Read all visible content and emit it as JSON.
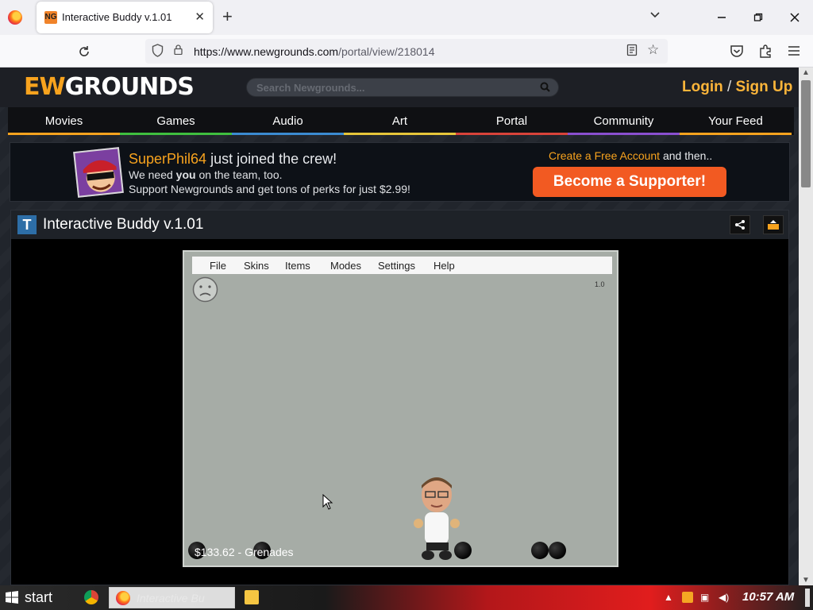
{
  "browser": {
    "tab_title": "Interactive Buddy v.1.01",
    "tab_favicon": "NG",
    "url_host": "https://www.newgrounds.com",
    "url_path": "/portal/view/218014"
  },
  "header": {
    "logo_accent": "EW",
    "logo_rest": "GROUNDS",
    "search_placeholder": "Search Newgrounds...",
    "login": "Login",
    "separator": "/",
    "signup": "Sign Up"
  },
  "nav": [
    {
      "label": "Movies",
      "color": "#f8a31e"
    },
    {
      "label": "Games",
      "color": "#3fbf3f"
    },
    {
      "label": "Audio",
      "color": "#3b8bd1"
    },
    {
      "label": "Art",
      "color": "#e6c63a"
    },
    {
      "label": "Portal",
      "color": "#d8433a"
    },
    {
      "label": "Community",
      "color": "#8a4fcf"
    },
    {
      "label": "Your Feed",
      "color": "#f8a31e"
    }
  ],
  "promo": {
    "username": "SuperPhil64",
    "joined": " just joined the crew!",
    "line2_prefix": "We need ",
    "line2_bold": "you",
    "line2_suffix": " on the team, too.",
    "line3": "Support Newgrounds and get tons of perks for just $2.99!",
    "create_link": "Create a Free Account",
    "create_suffix": " and then..",
    "supporter_button": "Become a Supporter!"
  },
  "content": {
    "type_letter": "T",
    "title": "Interactive Buddy v.1.01"
  },
  "game": {
    "menu": [
      "File",
      "Skins",
      "Items",
      "Modes",
      "Settings",
      "Help"
    ],
    "version": "1.0",
    "money": "$133.62",
    "money_sep": " - ",
    "item": "Grenades"
  },
  "taskbar": {
    "start_label": "start",
    "task_label": "Interactive Bu",
    "clock": "10:57 AM"
  },
  "colors": {
    "accent": "#f8a31e",
    "supporter": "#f25a22",
    "login": "#fdb53a"
  }
}
